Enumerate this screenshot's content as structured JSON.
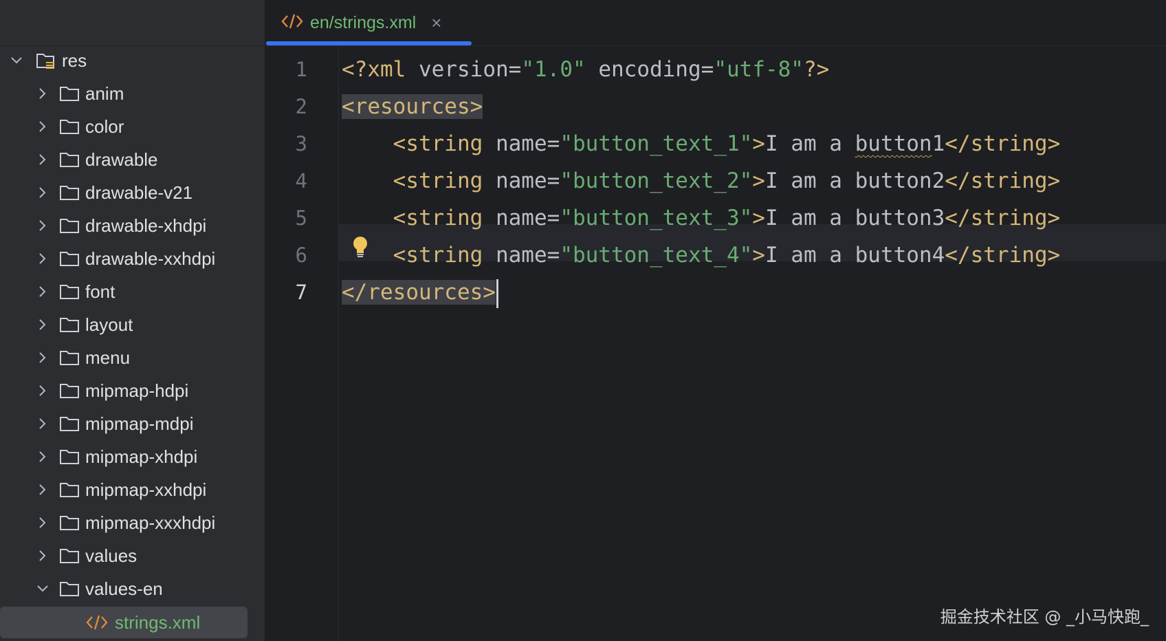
{
  "sidebar": {
    "root": {
      "label": "res",
      "expanded": true
    },
    "folders": [
      {
        "label": "anim",
        "expanded": false
      },
      {
        "label": "color",
        "expanded": false
      },
      {
        "label": "drawable",
        "expanded": false
      },
      {
        "label": "drawable-v21",
        "expanded": false
      },
      {
        "label": "drawable-xhdpi",
        "expanded": false
      },
      {
        "label": "drawable-xxhdpi",
        "expanded": false
      },
      {
        "label": "font",
        "expanded": false
      },
      {
        "label": "layout",
        "expanded": false
      },
      {
        "label": "menu",
        "expanded": false
      },
      {
        "label": "mipmap-hdpi",
        "expanded": false
      },
      {
        "label": "mipmap-mdpi",
        "expanded": false
      },
      {
        "label": "mipmap-xhdpi",
        "expanded": false
      },
      {
        "label": "mipmap-xxhdpi",
        "expanded": false
      },
      {
        "label": "mipmap-xxxhdpi",
        "expanded": false
      },
      {
        "label": "values",
        "expanded": false
      },
      {
        "label": "values-en",
        "expanded": true
      }
    ],
    "selected_file": {
      "label": "strings.xml",
      "icon": "xml-file-icon"
    }
  },
  "editor": {
    "tab": {
      "label": "en/strings.xml",
      "icon": "xml-file-icon",
      "close": "×"
    },
    "lines": [
      {
        "number": "1",
        "text": "<?xml version=\"1.0\" encoding=\"utf-8\"?>"
      },
      {
        "number": "2",
        "text": "<resources>"
      },
      {
        "number": "3",
        "text": "    <string name=\"button_text_1\">I am a button1</string>"
      },
      {
        "number": "4",
        "text": "    <string name=\"button_text_2\">I am a button2</string>"
      },
      {
        "number": "5",
        "text": "    <string name=\"button_text_3\">I am a button3</string>"
      },
      {
        "number": "6",
        "text": "    <string name=\"button_text_4\">I am a button4</string>"
      },
      {
        "number": "7",
        "text": "</resources>"
      }
    ],
    "current_line": "7",
    "intention_icon": "lightbulb-icon"
  },
  "watermark": "掘金技术社区 @ _小马快跑_",
  "colors": {
    "sidebar_bg": "#2b2d30",
    "editor_bg": "#1e1f22",
    "tab_accent": "#3574f0",
    "xml_tag": "#d5b778",
    "xml_value": "#6aab73",
    "file_green": "#6fbb73"
  }
}
